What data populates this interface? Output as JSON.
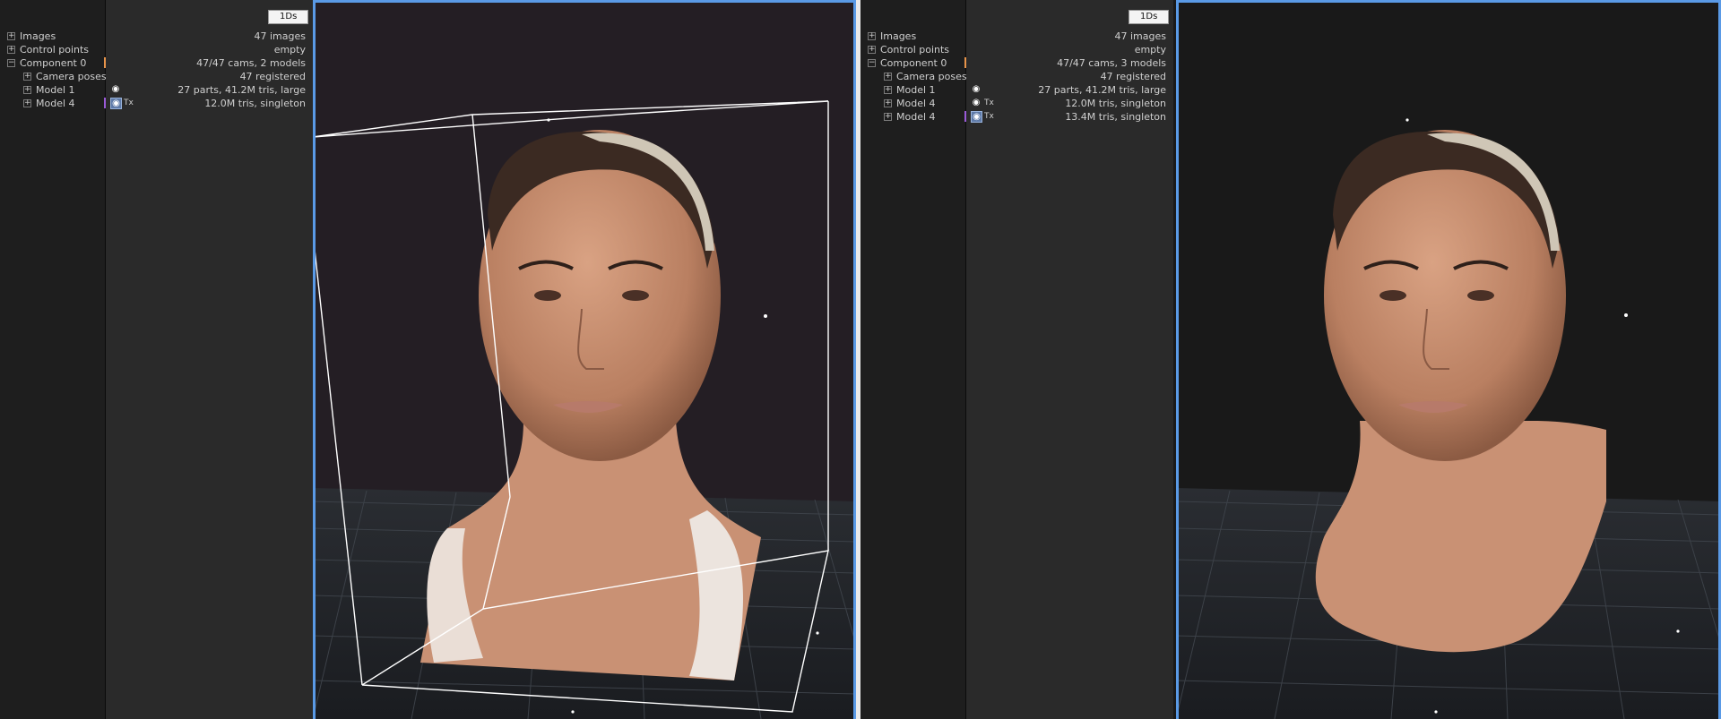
{
  "left_panel": {
    "badge": "1Ds",
    "tree": [
      {
        "label": "Images",
        "value": "47 images",
        "expander": "+",
        "indent": 0
      },
      {
        "label": "Control points",
        "value": "empty",
        "expander": "+",
        "indent": 0
      },
      {
        "label": "Component 0",
        "value": "47/47 cams, 2 models",
        "expander": "−",
        "indent": 0,
        "marker": "#e8944a"
      },
      {
        "label": "Camera poses",
        "value": "47 registered",
        "expander": "+",
        "indent": 1
      },
      {
        "label": "Model 1",
        "value": "27 parts, 41.2M tris, large",
        "expander": "+",
        "indent": 1,
        "eye": true
      },
      {
        "label": "Model 4",
        "value": "12.0M tris, singleton",
        "expander": "+",
        "indent": 1,
        "eye": true,
        "eye_active": true,
        "tx": "Tx",
        "marker": "#9a5ad8"
      }
    ]
  },
  "right_panel": {
    "badge": "1Ds",
    "tree": [
      {
        "label": "Images",
        "value": "47 images",
        "expander": "+",
        "indent": 0
      },
      {
        "label": "Control points",
        "value": "empty",
        "expander": "+",
        "indent": 0
      },
      {
        "label": "Component 0",
        "value": "47/47 cams, 3 models",
        "expander": "−",
        "indent": 0,
        "marker": "#e8944a"
      },
      {
        "label": "Camera poses",
        "value": "47 registered",
        "expander": "+",
        "indent": 1
      },
      {
        "label": "Model 1",
        "value": "27 parts, 41.2M tris, large",
        "expander": "+",
        "indent": 1,
        "eye": true
      },
      {
        "label": "Model 4",
        "value": "12.0M tris, singleton",
        "expander": "+",
        "indent": 1,
        "eye": true,
        "tx": "Tx"
      },
      {
        "label": "Model 4",
        "value": "13.4M tris, singleton",
        "expander": "+",
        "indent": 1,
        "eye": true,
        "eye_active": true,
        "tx": "Tx",
        "marker": "#9a5ad8"
      }
    ]
  },
  "icons": {
    "eye": "eye-icon",
    "expand": "plus-box-icon",
    "collapse": "minus-box-icon"
  },
  "colors": {
    "viewport_border": "#5a9ae6",
    "skin": "#c08a6a",
    "grid": "#3a3f45",
    "bbox": "#ffffff"
  }
}
